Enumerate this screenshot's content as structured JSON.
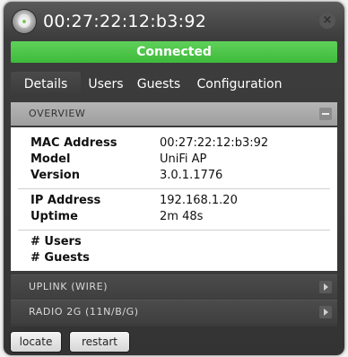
{
  "window": {
    "title": "00:27:22:12:b3:92",
    "status": "Connected",
    "status_color": "#45c141"
  },
  "tabs": [
    {
      "label": "Details",
      "active": true
    },
    {
      "label": "Users",
      "active": false
    },
    {
      "label": "Guests",
      "active": false
    },
    {
      "label": "Configuration",
      "active": false
    }
  ],
  "sections": {
    "overview": {
      "label": "OVERVIEW",
      "rows_top": [
        {
          "key": "MAC Address",
          "value": "00:27:22:12:b3:92"
        },
        {
          "key": "Model",
          "value": "UniFi AP"
        },
        {
          "key": "Version",
          "value": "3.0.1.1776"
        }
      ],
      "rows_mid": [
        {
          "key": "IP Address",
          "value": "192.168.1.20"
        },
        {
          "key": "Uptime",
          "value": "2m 48s"
        }
      ],
      "rows_bottom": [
        {
          "key": "# Users",
          "value": ""
        },
        {
          "key": "# Guests",
          "value": ""
        }
      ]
    },
    "uplink": {
      "label": "UPLINK (WIRE)"
    },
    "radio": {
      "label": "RADIO 2G (11N/B/G)"
    }
  },
  "actions": {
    "locate": "locate",
    "restart": "restart"
  },
  "icons": {
    "device": "access-point-icon",
    "close": "close-icon",
    "collapse": "minus-icon",
    "expand": "chevron-right-icon"
  }
}
